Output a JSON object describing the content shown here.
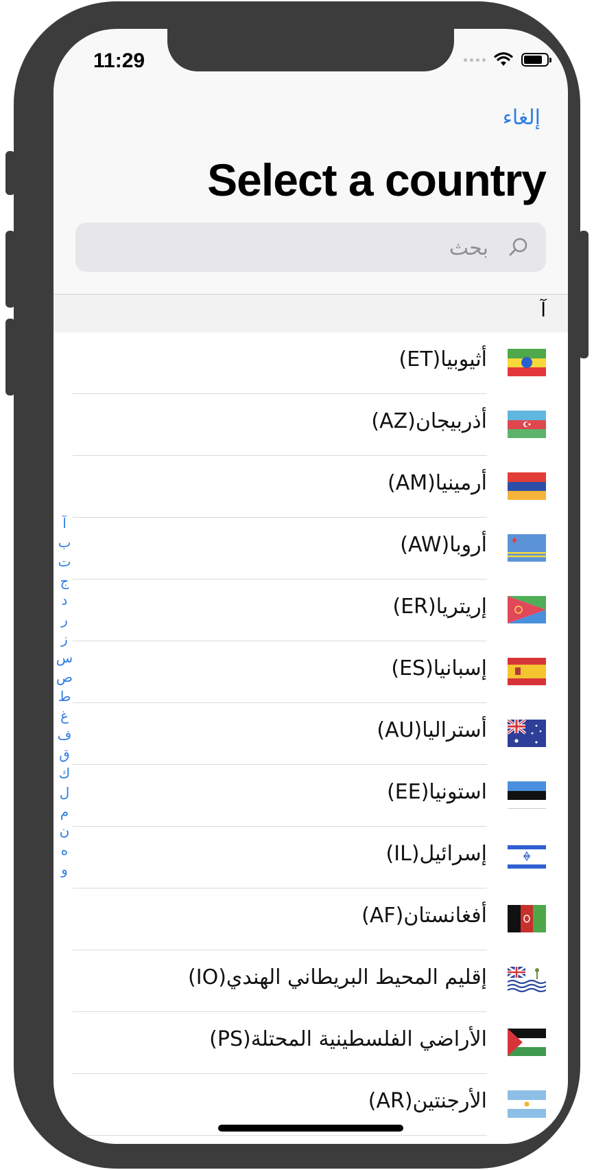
{
  "status_bar": {
    "time": "11:29"
  },
  "nav": {
    "cancel_label": "إلغاء",
    "title": "Select a country"
  },
  "search": {
    "placeholder": "بحث"
  },
  "section": {
    "label": "آ"
  },
  "countries": [
    {
      "label": "أثيوبيا(ET)",
      "flag": "ET"
    },
    {
      "label": "أذربيجان(AZ)",
      "flag": "AZ"
    },
    {
      "label": "أرمينيا(AM)",
      "flag": "AM"
    },
    {
      "label": "أروبا(AW)",
      "flag": "AW"
    },
    {
      "label": "إريتريا(ER)",
      "flag": "ER"
    },
    {
      "label": "إسبانيا(ES)",
      "flag": "ES"
    },
    {
      "label": "أستراليا(AU)",
      "flag": "AU"
    },
    {
      "label": "استونيا(EE)",
      "flag": "EE"
    },
    {
      "label": "إسرائيل(IL)",
      "flag": "IL"
    },
    {
      "label": "أفغانستان(AF)",
      "flag": "AF"
    },
    {
      "label": "إقليم المحيط البريطاني الهندي(IO)",
      "flag": "IO"
    },
    {
      "label": "الأراضي الفلسطينية المحتلة(PS)",
      "flag": "PS"
    },
    {
      "label": "الأرجنتين(AR)",
      "flag": "AR"
    }
  ],
  "index_letters": [
    "آ",
    "ب",
    "ت",
    "ج",
    "د",
    "ر",
    "ز",
    "س",
    "ص",
    "ط",
    "غ",
    "ف",
    "ق",
    "ك",
    "ل",
    "م",
    "ن",
    "ه",
    "و"
  ],
  "colors": {
    "accent": "#2f7de1",
    "frame": "#3c3c3c"
  }
}
